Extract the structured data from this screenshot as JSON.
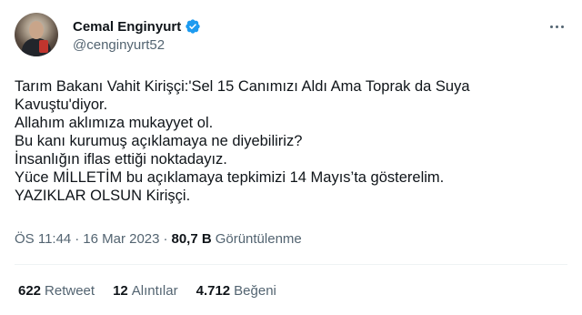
{
  "author": {
    "name": "Cemal Enginyurt",
    "handle": "@cenginyurt52",
    "verified_icon": "verified-badge-icon",
    "verified_color": "#1d9bf0"
  },
  "tweet": {
    "lines": [
      "Tarım Bakanı Vahit Kirişçi:'Sel 15 Canımızı Aldı Ama Toprak da Suya",
      "Kavuştu'diyor.",
      "Allahım aklımıza mukayyet ol.",
      "Bu kanı kurumuş açıklamaya ne diyebiliriz?",
      "İnsanlığın iflas ettiği noktadayız.",
      "Yüce MİLLETİM bu açıklamaya tepkimizi 14 Mayıs’ta gösterelim.",
      "YAZIKLAR OLSUN Kirişçi."
    ]
  },
  "meta": {
    "time": "ÖS 11:44",
    "separator": "·",
    "date": "16 Mar 2023",
    "views_count": "80,7 B",
    "views_label": "Görüntülenme"
  },
  "stats": {
    "retweets_count": "622",
    "retweets_label": "Retweet",
    "quotes_count": "12",
    "quotes_label": "Alıntılar",
    "likes_count": "4.712",
    "likes_label": "Beğeni"
  },
  "icons": {
    "more": "more-options-icon"
  }
}
